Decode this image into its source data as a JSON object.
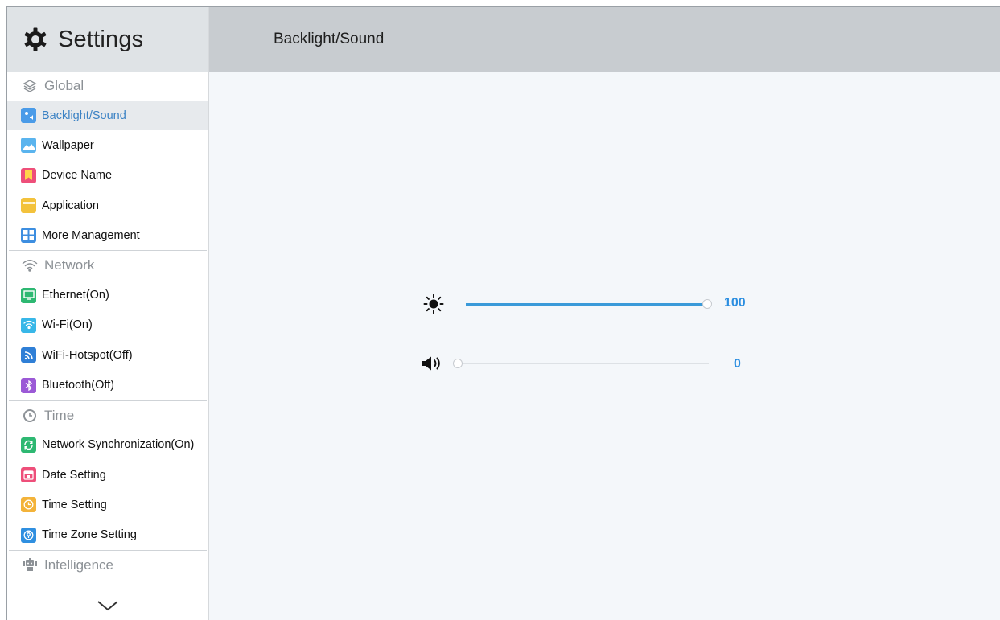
{
  "app": {
    "title": "Settings"
  },
  "header": {
    "page_title": "Backlight/Sound"
  },
  "sidebar": {
    "sections": [
      {
        "label": "Global",
        "icon": "layers-icon",
        "items": [
          {
            "label": "Backlight/Sound",
            "icon": "backlight-sound-icon",
            "color": "#4a9be8",
            "active": true
          },
          {
            "label": "Wallpaper",
            "icon": "wallpaper-icon",
            "color": "#5ab4ee"
          },
          {
            "label": "Device Name",
            "icon": "device-name-icon",
            "color": "#ee4f7a"
          },
          {
            "label": "Application",
            "icon": "application-icon",
            "color": "#f3c23c"
          },
          {
            "label": "More Management",
            "icon": "more-management-icon",
            "color": "#3d8ee0"
          }
        ]
      },
      {
        "label": "Network",
        "icon": "wifi-icon",
        "items": [
          {
            "label": "Ethernet(On)",
            "icon": "ethernet-icon",
            "color": "#2eb872"
          },
          {
            "label": "Wi-Fi(On)",
            "icon": "wifi-tile-icon",
            "color": "#38b7e8"
          },
          {
            "label": "WiFi-Hotspot(Off)",
            "icon": "hotspot-icon",
            "color": "#2f7fd6"
          },
          {
            "label": "Bluetooth(Off)",
            "icon": "bluetooth-icon",
            "color": "#9b59d6"
          }
        ]
      },
      {
        "label": "Time",
        "icon": "clock-icon",
        "items": [
          {
            "label": "Network Synchronization(On)",
            "icon": "sync-icon",
            "color": "#2eb872"
          },
          {
            "label": "Date Setting",
            "icon": "calendar-icon",
            "color": "#ee4f7a"
          },
          {
            "label": "Time Setting",
            "icon": "time-setting-icon",
            "color": "#f3b33a"
          },
          {
            "label": "Time Zone Setting",
            "icon": "time-zone-icon",
            "color": "#2f8fe0"
          }
        ]
      },
      {
        "label": "Intelligence",
        "icon": "robot-icon",
        "items": []
      }
    ]
  },
  "controls": {
    "brightness": {
      "icon": "brightness-icon",
      "value": "100",
      "fraction": 1.0
    },
    "volume": {
      "icon": "volume-icon",
      "value": "0",
      "fraction": 0.0
    }
  },
  "colors": {
    "accent": "#2b8ee0",
    "sidebar_active_text": "#3b82c4"
  }
}
